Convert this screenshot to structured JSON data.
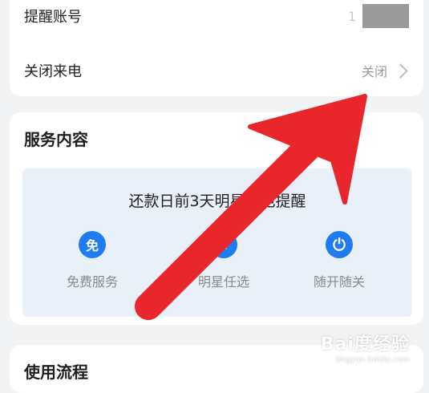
{
  "settings": {
    "account_label": "提醒账号",
    "account_prefix": "1",
    "close_call_label": "关闭来电",
    "close_call_status": "关闭"
  },
  "service": {
    "title": "服务内容",
    "panel_title": "还款日前3天明星来电提醒",
    "features": [
      {
        "label": "免费服务",
        "icon": "free-badge-icon",
        "glyph": "免"
      },
      {
        "label": "明星任选",
        "icon": "star-icon",
        "glyph": "★"
      },
      {
        "label": "随开随关",
        "icon": "power-icon",
        "glyph": "⏻"
      }
    ]
  },
  "process": {
    "title": "使用流程"
  },
  "watermark": {
    "main": "Bai度经验",
    "sub": "jingyan.baidu.com"
  },
  "colors": {
    "accent": "#1f7cf0",
    "arrow": "#e8262c",
    "panel_bg": "#eaf0f8"
  }
}
